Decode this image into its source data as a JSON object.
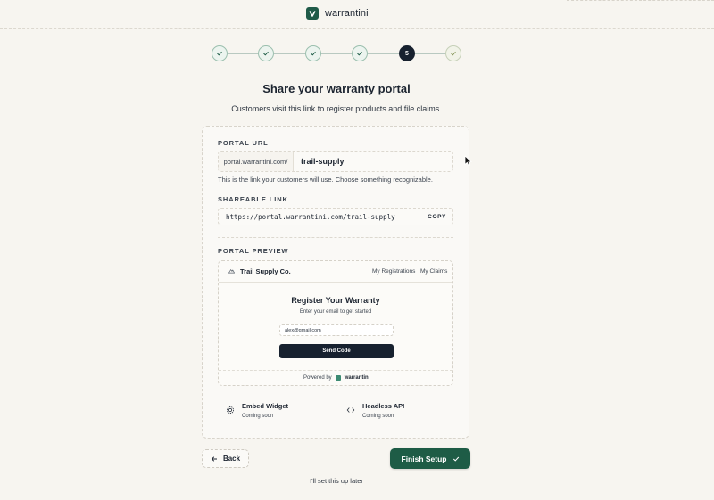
{
  "brand": {
    "name": "warrantini",
    "color": "#1f5a48"
  },
  "stepper": {
    "steps": [
      {
        "state": "done"
      },
      {
        "state": "done"
      },
      {
        "state": "done"
      },
      {
        "state": "done"
      },
      {
        "state": "current",
        "label": "5"
      },
      {
        "state": "pending"
      }
    ]
  },
  "header": {
    "title": "Share your warranty portal",
    "subtitle": "Customers visit this link to register products and file claims."
  },
  "portal_url": {
    "label": "PORTAL URL",
    "prefix": "portal.warrantini.com/",
    "value": "trail-supply",
    "help": "This is the link your customers will use. Choose something recognizable."
  },
  "shareable_link": {
    "label": "SHAREABLE LINK",
    "url": "https://portal.warrantini.com/trail-supply",
    "copy_label": "COPY"
  },
  "portal_preview": {
    "label": "PORTAL PREVIEW",
    "company": "Trail Supply Co.",
    "nav": [
      "My Registrations",
      "My Claims"
    ],
    "title": "Register Your Warranty",
    "subtitle": "Enter your email to get started",
    "email_value": "alex@gmail.com",
    "send_label": "Send Code",
    "powered_by": "Powered by",
    "powered_brand": "warrantini"
  },
  "options": [
    {
      "title": "Embed Widget",
      "status": "Coming soon",
      "icon": "gear-icon"
    },
    {
      "title": "Headless API",
      "status": "Coming soon",
      "icon": "code-icon"
    }
  ],
  "actions": {
    "back_label": "Back",
    "finish_label": "Finish Setup",
    "later_label": "I'll set this up later"
  },
  "colors": {
    "accent": "#1e5c46",
    "dark": "#17212f",
    "background": "#f7f5f0"
  }
}
